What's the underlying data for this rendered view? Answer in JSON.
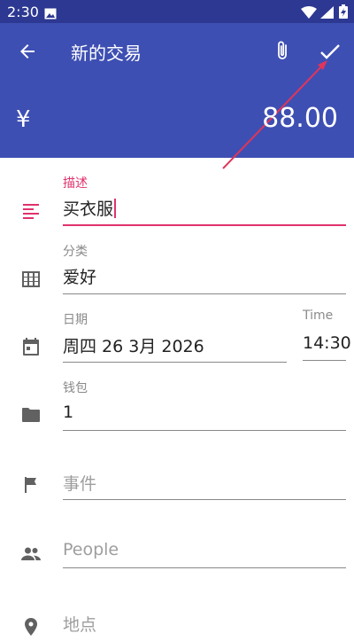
{
  "status_bar": {
    "time": "2:30",
    "icons": [
      "gallery-icon",
      "wifi-icon",
      "signal-icon",
      "battery-charging-icon"
    ]
  },
  "app_bar": {
    "title": "新的交易",
    "currency_symbol": "¥",
    "amount": "88.00",
    "background_color": "#3e4fb3",
    "status_bar_color": "#2c3891"
  },
  "form": {
    "description": {
      "label": "描述",
      "value": "买衣服",
      "icon": "notes-icon"
    },
    "category": {
      "label": "分类",
      "value": "爱好",
      "icon": "grid-icon"
    },
    "date": {
      "label": "日期",
      "value": "周四 26 3月 2026",
      "icon": "calendar-icon"
    },
    "time": {
      "label": "Time",
      "value": "14:30"
    },
    "wallet": {
      "label": "钱包",
      "value": "1",
      "icon": "folder-icon"
    },
    "event": {
      "placeholder": "事件",
      "icon": "flag-icon"
    },
    "people": {
      "placeholder": "People",
      "icon": "people-icon"
    },
    "place": {
      "placeholder": "地点",
      "icon": "location-icon"
    }
  },
  "colors": {
    "accent": "#e0326e",
    "annotation_arrow": "#e0355a"
  }
}
